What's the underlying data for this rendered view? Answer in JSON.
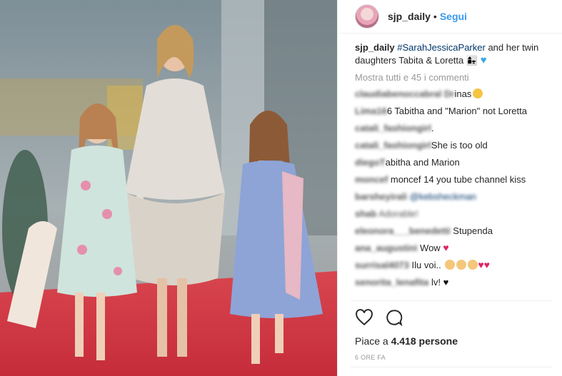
{
  "post": {
    "username": "sjp_daily",
    "follow_label": "Segui",
    "separator": "•",
    "caption_user": "sjp_daily",
    "caption_hashtag": "#SarahJessicaParker",
    "caption_text": "and her twin daughters Tabita & Loretta",
    "show_all": "Mostra tutti e 45 i commenti",
    "likes_prefix": "Piace a",
    "likes_count": "4.418",
    "likes_suffix": "persone",
    "time": "6 ORE FA"
  },
  "comments": [
    {
      "user": "claudiabenoccabral Dr",
      "text": "inas"
    },
    {
      "user": "Lima16",
      "text": "6 Tabitha and \"Marion\" not Loretta"
    },
    {
      "user": "catali_fashiongirl",
      "text": "."
    },
    {
      "user": "catali_fashiongirl",
      "text": "She is too old"
    },
    {
      "user": "diegoT",
      "text": "abitha and Marion"
    },
    {
      "user": "moncef",
      "text": "moncef 14 you tube channel kiss"
    },
    {
      "user": "barsheyirali",
      "text": "@kebsheckman"
    },
    {
      "user": "shab",
      "text": "Adorable!"
    },
    {
      "user": "eleonora___benedetti",
      "text": "Stupenda"
    },
    {
      "user": "ana_augustini",
      "text": "Wow"
    },
    {
      "user": "surrisal4073",
      "text": "Ilu voi.."
    },
    {
      "user": "senorita_lenafita",
      "text": "lv!"
    }
  ],
  "colors": {
    "link": "#3897f0",
    "hashtag": "#003569",
    "heart": "#e0245e",
    "muted": "#999999"
  },
  "icons": [
    "heart-outline-icon",
    "comment-bubble-icon",
    "couple-emoji",
    "blue-heart-emoji",
    "heart-eyes-emoji",
    "red-heart-emoji",
    "woman-emoji",
    "black-heart-emoji"
  ]
}
